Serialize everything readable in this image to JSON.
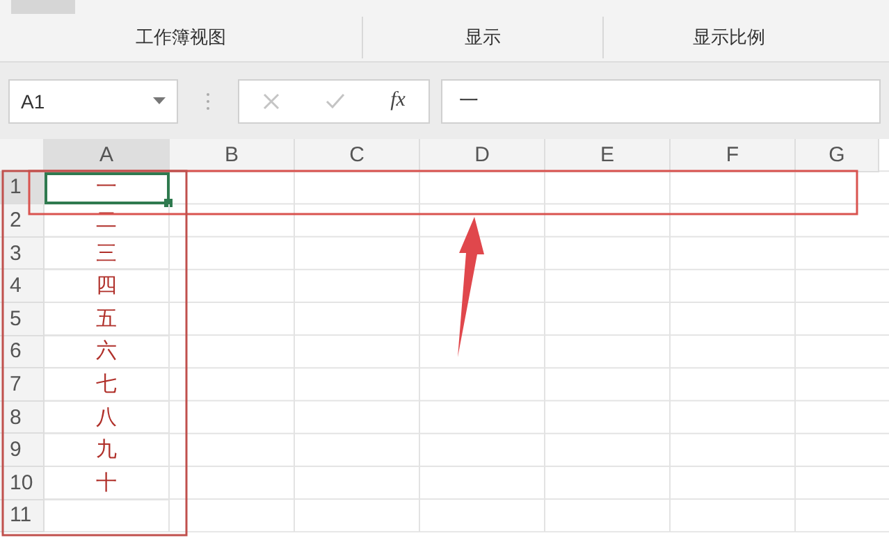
{
  "ribbon_groups": [
    {
      "label": "工作簿视图"
    },
    {
      "label": "显示"
    },
    {
      "label": "显示比例"
    }
  ],
  "formula_bar": {
    "name_box": "A1",
    "function_label": "fx",
    "formula": "一"
  },
  "columns": [
    {
      "label": "A",
      "selected": true
    },
    {
      "label": "B",
      "selected": false
    },
    {
      "label": "C",
      "selected": false
    },
    {
      "label": "D",
      "selected": false
    },
    {
      "label": "E",
      "selected": false
    },
    {
      "label": "F",
      "selected": false
    },
    {
      "label": "G",
      "selected": false
    }
  ],
  "rows": [
    {
      "number": "1",
      "selected": true,
      "value": "一"
    },
    {
      "number": "2",
      "selected": false,
      "value": "二"
    },
    {
      "number": "3",
      "selected": false,
      "value": "三"
    },
    {
      "number": "4",
      "selected": false,
      "value": "四"
    },
    {
      "number": "5",
      "selected": false,
      "value": "五"
    },
    {
      "number": "6",
      "selected": false,
      "value": "六"
    },
    {
      "number": "7",
      "selected": false,
      "value": "七"
    },
    {
      "number": "8",
      "selected": false,
      "value": "八"
    },
    {
      "number": "9",
      "selected": false,
      "value": "九"
    },
    {
      "number": "10",
      "selected": false,
      "value": "十"
    },
    {
      "number": "11",
      "selected": false,
      "value": ""
    }
  ]
}
